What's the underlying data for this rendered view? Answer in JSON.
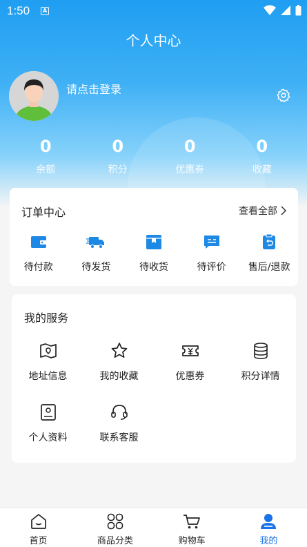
{
  "status_bar": {
    "time": "1:50",
    "app_badge": "A"
  },
  "page_title": "个人中心",
  "user": {
    "login_prompt": "请点击登录"
  },
  "stats": [
    {
      "value": "0",
      "label": "余额"
    },
    {
      "value": "0",
      "label": "积分"
    },
    {
      "value": "0",
      "label": "优惠券"
    },
    {
      "value": "0",
      "label": "收藏"
    }
  ],
  "orders": {
    "title": "订单中心",
    "view_all": "查看全部",
    "items": [
      {
        "label": "待付款",
        "icon": "wallet-icon"
      },
      {
        "label": "待发货",
        "icon": "truck-icon"
      },
      {
        "label": "待收货",
        "icon": "package-icon"
      },
      {
        "label": "待评价",
        "icon": "comment-icon"
      },
      {
        "label": "售后/退款",
        "icon": "refund-icon"
      }
    ]
  },
  "services": {
    "title": "我的服务",
    "items": [
      {
        "label": "地址信息",
        "icon": "map-icon"
      },
      {
        "label": "我的收藏",
        "icon": "star-icon"
      },
      {
        "label": "优惠券",
        "icon": "coupon-icon"
      },
      {
        "label": "积分详情",
        "icon": "coins-icon"
      },
      {
        "label": "个人资料",
        "icon": "profile-icon"
      },
      {
        "label": "联系客服",
        "icon": "headset-icon"
      }
    ]
  },
  "tabbar": [
    {
      "label": "首页",
      "icon": "home-icon",
      "active": false
    },
    {
      "label": "商品分类",
      "icon": "category-icon",
      "active": false
    },
    {
      "label": "购物车",
      "icon": "cart-icon",
      "active": false
    },
    {
      "label": "我的",
      "icon": "user-icon",
      "active": true
    }
  ],
  "colors": {
    "primary": "#1a9bf0",
    "accent": "#1a73e8",
    "icon_blue": "#1e88e5"
  }
}
